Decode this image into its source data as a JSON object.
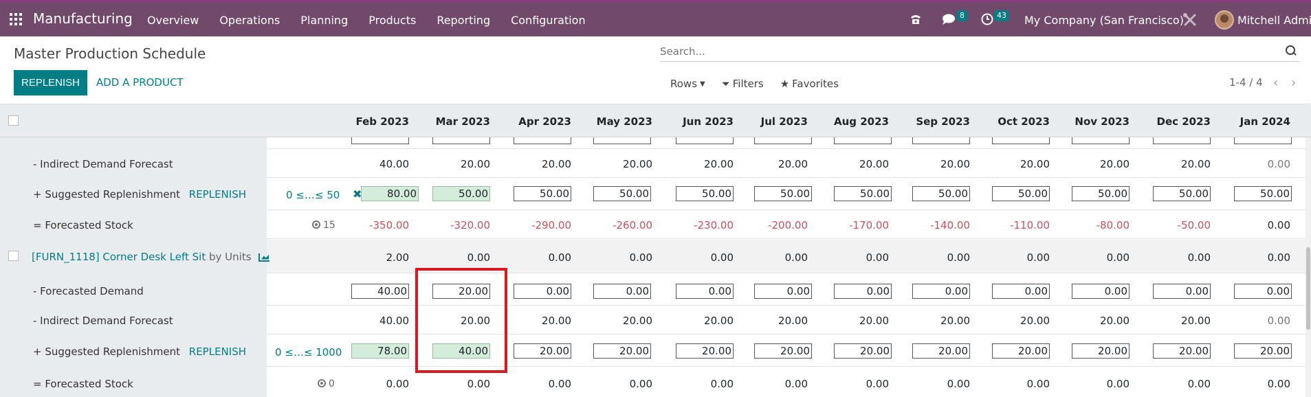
{
  "navbar": {
    "brand": "Manufacturing",
    "menu": [
      "Overview",
      "Operations",
      "Planning",
      "Products",
      "Reporting",
      "Configuration"
    ],
    "messages_count": "8",
    "activities_count": "43",
    "company": "My Company (San Francisco)",
    "user": "Mitchell Admin",
    "icons": [
      "apps-grid-icon",
      "phone-icon",
      "chat-icon",
      "clock-icon",
      "tools-icon"
    ]
  },
  "control": {
    "title": "Master Production Schedule",
    "replenish_label": "REPLENISH",
    "add_product_label": "ADD A PRODUCT",
    "search_placeholder": "Search...",
    "rows_label": "Rows",
    "filters_label": "Filters",
    "favorites_label": "Favorites",
    "pager": "1-4 / 4"
  },
  "months": [
    "Feb 2023",
    "Mar 2023",
    "Apr 2023",
    "May 2023",
    "Jun 2023",
    "Jul 2023",
    "Aug 2023",
    "Sep 2023",
    "Oct 2023",
    "Nov 2023",
    "Dec 2023",
    "Jan 2024"
  ],
  "block1": {
    "indirect_label": "- Indirect Demand Forecast",
    "indirect": [
      "40.00",
      "20.00",
      "20.00",
      "20.00",
      "20.00",
      "20.00",
      "20.00",
      "20.00",
      "20.00",
      "20.00",
      "20.00",
      "0.00"
    ],
    "suggested_label": "+ Suggested Replenishment",
    "replenish_link": "REPLENISH",
    "range": "0 ≤…≤ 50",
    "suggested": [
      "80.00",
      "50.00",
      "50.00",
      "50.00",
      "50.00",
      "50.00",
      "50.00",
      "50.00",
      "50.00",
      "50.00",
      "50.00",
      "50.00"
    ],
    "forecast_label": "= Forecasted Stock",
    "stock_start": "15",
    "forecast": [
      "-350.00",
      "-320.00",
      "-290.00",
      "-260.00",
      "-230.00",
      "-200.00",
      "-170.00",
      "-140.00",
      "-110.00",
      "-80.00",
      "-50.00",
      "0.00"
    ]
  },
  "block2": {
    "product_name": "[FURN_1118] Corner Desk Left Sit",
    "by_units": "by Units",
    "product_row": [
      "2.00",
      "0.00",
      "0.00",
      "0.00",
      "0.00",
      "0.00",
      "0.00",
      "0.00",
      "0.00",
      "0.00",
      "0.00",
      "0.00"
    ],
    "demand_label": "- Forecasted Demand",
    "demand": [
      "40.00",
      "20.00",
      "0.00",
      "0.00",
      "0.00",
      "0.00",
      "0.00",
      "0.00",
      "0.00",
      "0.00",
      "0.00",
      "0.00"
    ],
    "indirect_label": "- Indirect Demand Forecast",
    "indirect": [
      "40.00",
      "20.00",
      "20.00",
      "20.00",
      "20.00",
      "20.00",
      "20.00",
      "20.00",
      "20.00",
      "20.00",
      "20.00",
      "0.00"
    ],
    "suggested_label": "+ Suggested Replenishment",
    "replenish_link": "REPLENISH",
    "range": "0 ≤…≤ 1000",
    "suggested": [
      "78.00",
      "40.00",
      "20.00",
      "20.00",
      "20.00",
      "20.00",
      "20.00",
      "20.00",
      "20.00",
      "20.00",
      "20.00",
      "20.00"
    ],
    "forecast_label": "= Forecasted Stock",
    "stock_start": "0",
    "forecast": [
      "0.00",
      "0.00",
      "0.00",
      "0.00",
      "0.00",
      "0.00",
      "0.00",
      "0.00",
      "0.00",
      "0.00",
      "0.00",
      "0.00"
    ]
  }
}
